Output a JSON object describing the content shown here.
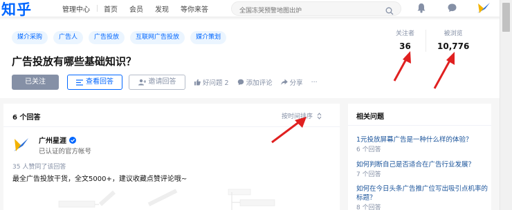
{
  "topbar": {
    "logo": "知乎",
    "nav": [
      "管理中心",
      "首页",
      "会员",
      "发现",
      "等你来答"
    ],
    "search_placeholder": "全国冻哭预警地图出炉",
    "icons": [
      "search-icon",
      "bell-icon",
      "chat-icon",
      "avatar"
    ]
  },
  "question": {
    "tags": [
      "媒介采购",
      "广告人",
      "广告投放",
      "互联网广告投放",
      "媒介策划"
    ],
    "title": "广告投放有哪些基础知识？",
    "follow_button": "已关注",
    "view_answers_button": "查看回答",
    "invite_button": "邀请回答",
    "good_question": "好问题 2",
    "add_comment": "添加评论",
    "share": "分享",
    "more": "···",
    "stats": {
      "followers_label": "关注者",
      "followers_value": "36",
      "views_label": "被浏览",
      "views_value": "10,776"
    }
  },
  "answers": {
    "count": "6 个回答",
    "sort_label": "按时间排序",
    "author": {
      "name": "广州星涯",
      "desc": "已认证的官方帐号"
    },
    "upvotes": "35 人赞同了该回答",
    "excerpt": "最全广告投放干货，全文5000+，建议收藏点赞评论哦~"
  },
  "related": {
    "title": "相关问题",
    "items": [
      {
        "q": "1元投放屏幕广告是一种什么样的体验？",
        "c": "6 个回答"
      },
      {
        "q": "如何判断自己是否适合在广告行业发展？",
        "c": "7 个回答"
      },
      {
        "q": "如何在今日头条广告推广位写出吸引点机率的标题？",
        "c": "8 个回答"
      }
    ]
  },
  "colors": {
    "brand": "#0066ff",
    "annotation": "#e02020"
  }
}
